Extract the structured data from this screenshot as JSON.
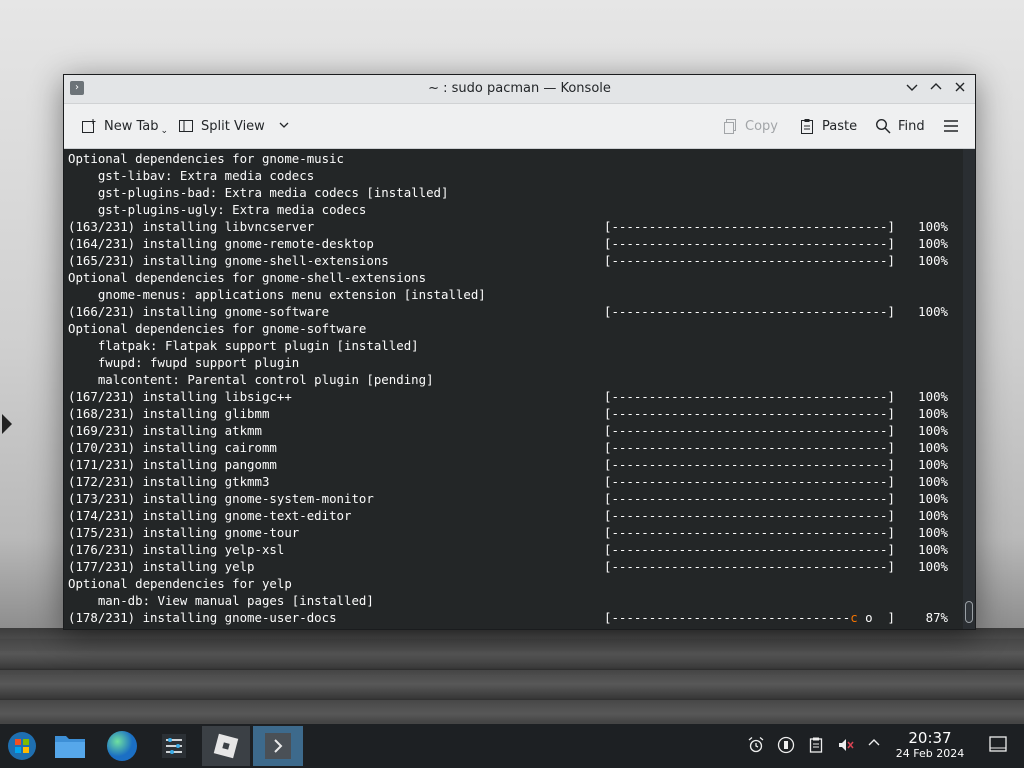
{
  "window": {
    "title": "~ : sudo pacman — Konsole",
    "titlebar_buttons": [
      "chevron-down-icon",
      "chevron-up-icon",
      "close-icon"
    ]
  },
  "toolbar": {
    "new_tab": "New Tab",
    "split_view": "Split View",
    "copy": "Copy",
    "paste": "Paste",
    "find": "Find"
  },
  "terminal": {
    "lines": [
      {
        "text": "Optional dependencies for gnome-music",
        "progress": null,
        "pct": null
      },
      {
        "text": "    gst-libav: Extra media codecs",
        "progress": null,
        "pct": null
      },
      {
        "text": "    gst-plugins-bad: Extra media codecs [installed]",
        "progress": null,
        "pct": null
      },
      {
        "text": "    gst-plugins-ugly: Extra media codecs",
        "progress": null,
        "pct": null
      },
      {
        "text": "(163/231) installing libvncserver",
        "progress": "[-------------------------------------]",
        "pct": "100%"
      },
      {
        "text": "(164/231) installing gnome-remote-desktop",
        "progress": "[-------------------------------------]",
        "pct": "100%"
      },
      {
        "text": "(165/231) installing gnome-shell-extensions",
        "progress": "[-------------------------------------]",
        "pct": "100%"
      },
      {
        "text": "Optional dependencies for gnome-shell-extensions",
        "progress": null,
        "pct": null
      },
      {
        "text": "    gnome-menus: applications menu extension [installed]",
        "progress": null,
        "pct": null
      },
      {
        "text": "(166/231) installing gnome-software",
        "progress": "[-------------------------------------]",
        "pct": "100%"
      },
      {
        "text": "Optional dependencies for gnome-software",
        "progress": null,
        "pct": null
      },
      {
        "text": "    flatpak: Flatpak support plugin [installed]",
        "progress": null,
        "pct": null
      },
      {
        "text": "    fwupd: fwupd support plugin",
        "progress": null,
        "pct": null
      },
      {
        "text": "    malcontent: Parental control plugin [pending]",
        "progress": null,
        "pct": null
      },
      {
        "text": "(167/231) installing libsigc++",
        "progress": "[-------------------------------------]",
        "pct": "100%"
      },
      {
        "text": "(168/231) installing glibmm",
        "progress": "[-------------------------------------]",
        "pct": "100%"
      },
      {
        "text": "(169/231) installing atkmm",
        "progress": "[-------------------------------------]",
        "pct": "100%"
      },
      {
        "text": "(170/231) installing cairomm",
        "progress": "[-------------------------------------]",
        "pct": "100%"
      },
      {
        "text": "(171/231) installing pangomm",
        "progress": "[-------------------------------------]",
        "pct": "100%"
      },
      {
        "text": "(172/231) installing gtkmm3",
        "progress": "[-------------------------------------]",
        "pct": "100%"
      },
      {
        "text": "(173/231) installing gnome-system-monitor",
        "progress": "[-------------------------------------]",
        "pct": "100%"
      },
      {
        "text": "(174/231) installing gnome-text-editor",
        "progress": "[-------------------------------------]",
        "pct": "100%"
      },
      {
        "text": "(175/231) installing gnome-tour",
        "progress": "[-------------------------------------]",
        "pct": "100%"
      },
      {
        "text": "(176/231) installing yelp-xsl",
        "progress": "[-------------------------------------]",
        "pct": "100%"
      },
      {
        "text": "(177/231) installing yelp",
        "progress": "[-------------------------------------]",
        "pct": "100%"
      },
      {
        "text": "Optional dependencies for yelp",
        "progress": null,
        "pct": null
      },
      {
        "text": "    man-db: View manual pages [installed]",
        "progress": null,
        "pct": null
      },
      {
        "text": "(178/231) installing gnome-user-docs",
        "progress": "[--------------------------------",
        "pct": "87%",
        "pacman": "c",
        "dot": "o",
        "tail": "  ]"
      }
    ]
  },
  "taskbar": {
    "apps": [
      "start-menu-icon",
      "file-manager-icon",
      "browser-icon",
      "settings-icon",
      "roblox-icon",
      "konsole-icon"
    ],
    "tray": [
      "alarm-icon",
      "network-icon",
      "clipboard-icon",
      "volume-muted-icon",
      "chevron-up-icon"
    ],
    "clock_time": "20:37",
    "clock_date": "24 Feb 2024"
  },
  "colors": {
    "terminal_bg": "#232627",
    "terminal_fg": "#fcfcfc",
    "pacman_accent": "#f67400",
    "taskbar_bg": "#1d2023"
  }
}
